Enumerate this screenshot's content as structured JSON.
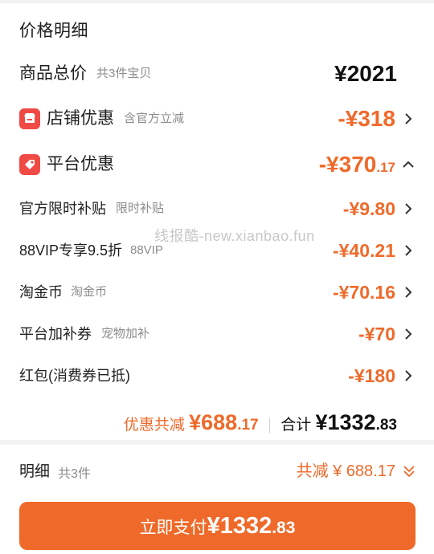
{
  "header": {
    "title": "价格明细"
  },
  "total": {
    "label": "商品总价",
    "sub": "共3件宝贝",
    "amount": "¥2021"
  },
  "shop_discount": {
    "label": "店铺优惠",
    "sub": "含官方立减",
    "amount": "-¥318",
    "icon": "shop-icon"
  },
  "platform_discount": {
    "label": "平台优惠",
    "amount_int": "-¥370",
    "amount_dec": ".17",
    "icon": "tag-icon"
  },
  "items": [
    {
      "label": "官方限时补贴",
      "sub": "限时补贴",
      "amount": "-¥9.80"
    },
    {
      "label": "88VIP专享9.5折",
      "sub": "88VIP",
      "amount": "-¥40.21"
    },
    {
      "label": "淘金币",
      "sub": "淘金币",
      "amount": "-¥70.16"
    },
    {
      "label": "平台加补券",
      "sub": "宠物加补",
      "amount": "-¥70"
    },
    {
      "label": "红包(消费券已抵)",
      "sub": "",
      "amount": "-¥180"
    }
  ],
  "watermark": "线报酷-new.xianbao.fun",
  "summary": {
    "discount_label": "优惠共减",
    "discount_int": "¥688",
    "discount_dec": ".17",
    "total_label": "合计",
    "total_int": "¥1332",
    "total_dec": ".83"
  },
  "detail": {
    "label": "明细",
    "sub": "共3件",
    "right": "共减 ¥ 688.17"
  },
  "pay": {
    "label": "立即支付",
    "int": "¥1332",
    "dec": ".83"
  },
  "colors": {
    "accent": "#ef6a2a",
    "icon_red": "#f04a45"
  }
}
